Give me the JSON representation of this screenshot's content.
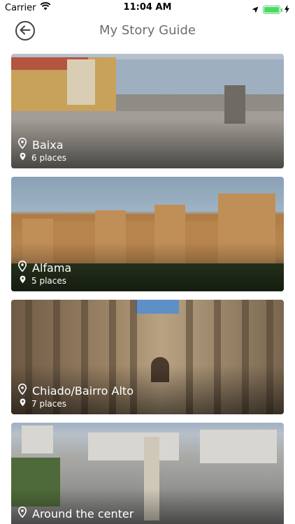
{
  "status_bar": {
    "carrier": "Carrier",
    "time": "11:04 AM"
  },
  "nav": {
    "title": "My Story Guide"
  },
  "cards": [
    {
      "name": "Baixa",
      "places": "6 places"
    },
    {
      "name": "Alfama",
      "places": "5 places"
    },
    {
      "name": "Chiado/Bairro Alto",
      "places": "7 places"
    },
    {
      "name": "Around the center",
      "places": ""
    }
  ],
  "colors": {
    "battery": "#4cd964",
    "title_gray": "#6e6e6e"
  },
  "icons": [
    "wifi-icon",
    "location-arrow-icon",
    "battery-icon",
    "charging-bolt-icon",
    "back-arrow-icon",
    "location-pin-icon"
  ]
}
